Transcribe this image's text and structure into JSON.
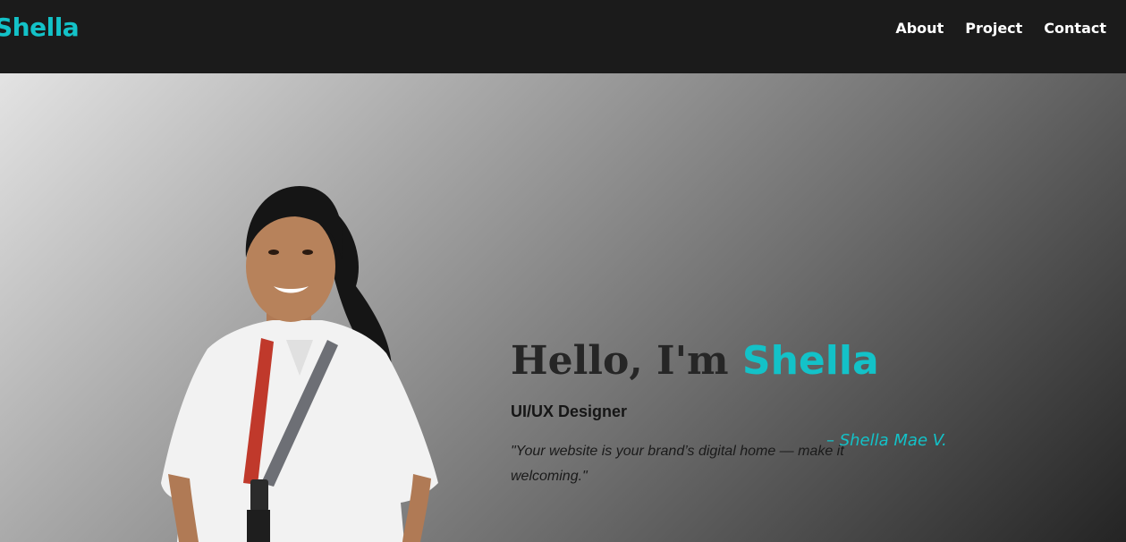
{
  "nav": {
    "brand": "Shella",
    "links": [
      "About",
      "Project",
      "Contact"
    ]
  },
  "hero": {
    "greeting": "Hello, I'm ",
    "name": "Shella",
    "role": "UI/UX Designer",
    "quote": "\"Your website is your brand’s digital home — make it welcoming.\"",
    "signature": "– Shella Mae V."
  },
  "colors": {
    "accent": "#13c2c8",
    "navbar": "#1b1b1b"
  }
}
